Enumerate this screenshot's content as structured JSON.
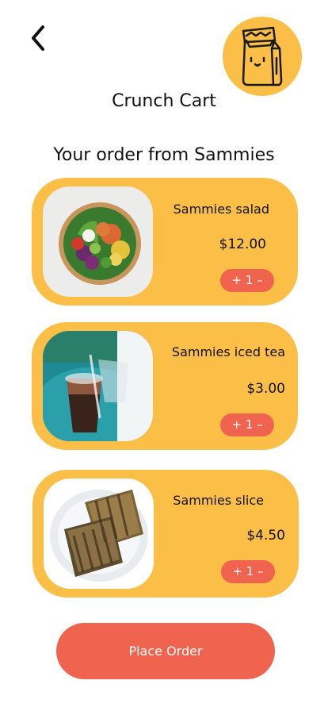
{
  "app": {
    "title": "Crunch Cart"
  },
  "order": {
    "heading": "Your order from Sammies"
  },
  "items": [
    {
      "name": "Sammies salad",
      "price": "$12.00",
      "qty_label": "+ 1 –",
      "image": "salad-bowl-photo"
    },
    {
      "name": "Sammies iced tea",
      "price": "$3.00",
      "qty_label": "+ 1 –",
      "image": "iced-tea-photo"
    },
    {
      "name": "Sammies slice",
      "price": "$4.50",
      "qty_label": "+ 1 –",
      "image": "toast-slice-photo"
    }
  ],
  "actions": {
    "place_order": "Place Order"
  },
  "icons": {
    "back": "chevron-left-icon",
    "logo": "shopping-bag-mascot-icon"
  },
  "colors": {
    "accent": "#fbbf47",
    "button": "#f0634f",
    "background": "#ffffff"
  }
}
